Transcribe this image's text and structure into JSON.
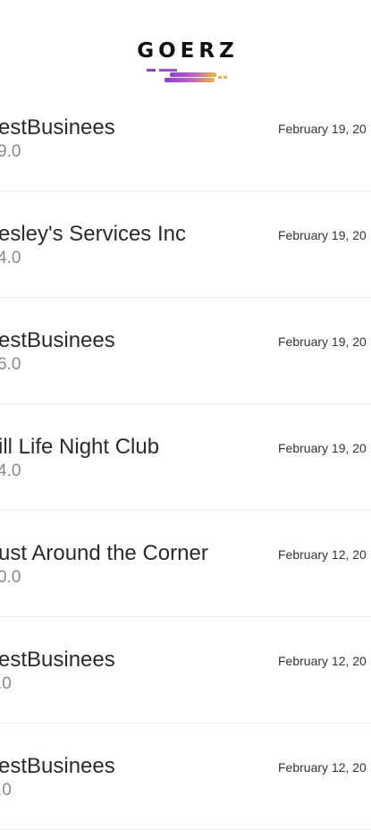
{
  "header": {
    "logo_text": "GOERZ",
    "logo_colors": [
      "#8e3bd9",
      "#c05ad0",
      "#f2b53a"
    ]
  },
  "transactions": [
    {
      "title": "estBusinees",
      "amount": "9.0",
      "date": "February 19, 20"
    },
    {
      "title": "esley's Services Inc",
      "amount": "4.0",
      "date": "February 19, 20"
    },
    {
      "title": "estBusinees",
      "amount": "6.0",
      "date": "February 19, 20"
    },
    {
      "title": "ill Life Night Club",
      "amount": "4.0",
      "date": "February 19, 20"
    },
    {
      "title": "ust Around the Corner",
      "amount": "0.0",
      "date": "February 12, 20"
    },
    {
      "title": "estBusinees",
      "amount": ".0",
      "date": "February 12, 20"
    },
    {
      "title": "estBusinees",
      "amount": ".0",
      "date": "February 12, 20"
    }
  ]
}
